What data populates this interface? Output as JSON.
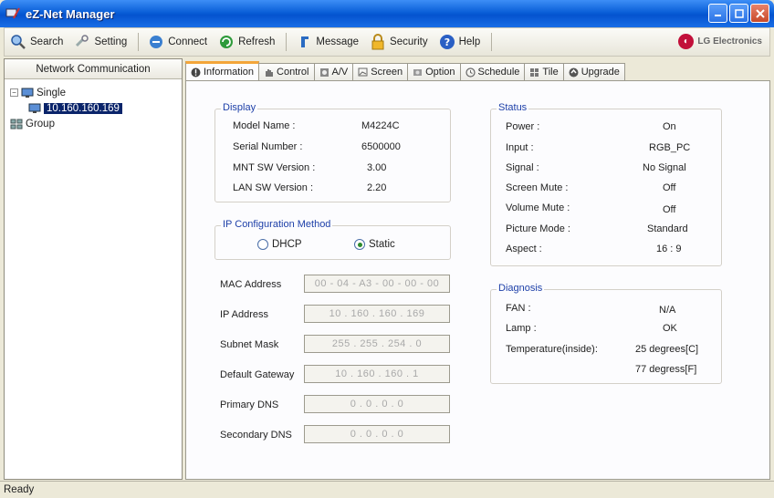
{
  "window": {
    "title": "eZ-Net Manager"
  },
  "toolbar": {
    "search": "Search",
    "setting": "Setting",
    "connect": "Connect",
    "refresh": "Refresh",
    "message": "Message",
    "security": "Security",
    "help": "Help",
    "brand": "LG Electronics"
  },
  "left": {
    "header": "Network Communication",
    "tree": {
      "single": "Single",
      "device": "10.160.160.169",
      "group": "Group"
    }
  },
  "tabs": [
    "Information",
    "Control",
    "A/V",
    "Screen",
    "Option",
    "Schedule",
    "Tile",
    "Upgrade"
  ],
  "display": {
    "title": "Display",
    "rows": [
      {
        "label": "Model Name :",
        "value": "M4224C"
      },
      {
        "label": "Serial Number :",
        "value": "6500000"
      },
      {
        "label": "MNT SW Version :",
        "value": "3.00"
      },
      {
        "label": "LAN SW Version :",
        "value": "2.20"
      }
    ]
  },
  "ipconfig": {
    "title": "IP Configuration Method",
    "dhcp": "DHCP",
    "static": "Static",
    "selected": "Static"
  },
  "network": [
    {
      "label": "MAC Address",
      "value": "00 - 04 - A3 - 00 - 00 - 00"
    },
    {
      "label": "IP Address",
      "value": "10 . 160 . 160 . 169"
    },
    {
      "label": "Subnet Mask",
      "value": "255 . 255 . 254 . 0"
    },
    {
      "label": "Default Gateway",
      "value": "10 . 160 . 160 . 1"
    },
    {
      "label": "Primary DNS",
      "value": "0 . 0 . 0 . 0"
    },
    {
      "label": "Secondary DNS",
      "value": "0 . 0 . 0 . 0"
    }
  ],
  "status": {
    "title": "Status",
    "rows": [
      {
        "label": "Power :",
        "value": "On"
      },
      {
        "label": "Input :",
        "value": "RGB_PC"
      },
      {
        "label": "Signal :",
        "value": "No Signal"
      },
      {
        "label": "Screen Mute :",
        "value": "Off"
      },
      {
        "label": "Volume Mute :",
        "value": "Off"
      },
      {
        "label": "Picture Mode :",
        "value": "Standard"
      },
      {
        "label": "Aspect :",
        "value": "16 : 9"
      }
    ]
  },
  "diagnosis": {
    "title": "Diagnosis",
    "rows": [
      {
        "label": "FAN :",
        "value": "N/A"
      },
      {
        "label": "Lamp :",
        "value": "OK"
      },
      {
        "label": "Temperature(inside):",
        "value": "25 degrees[C]"
      },
      {
        "label": "",
        "value": "77 degress[F]"
      }
    ]
  },
  "statusbar": {
    "text": "Ready"
  }
}
